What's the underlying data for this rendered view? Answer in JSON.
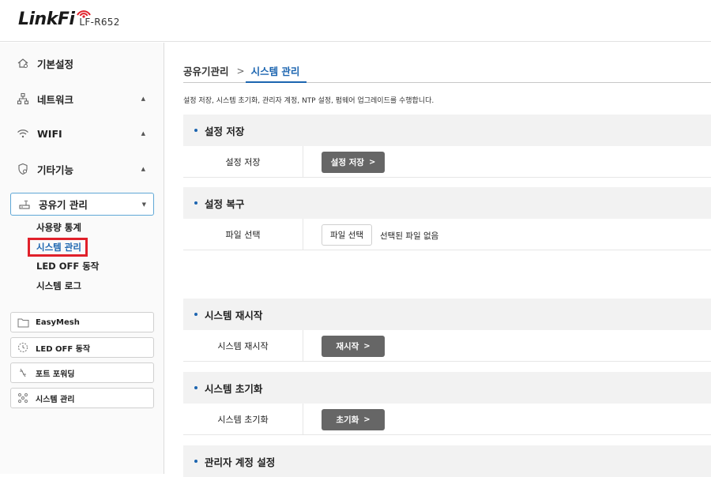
{
  "header": {
    "brand": "LinkFi",
    "model": "LF-R652"
  },
  "sidebar": {
    "menu": [
      {
        "label": "기본설정",
        "icon": "home-gear-icon"
      },
      {
        "label": "네트워크",
        "icon": "network-icon",
        "arrow": "▲"
      },
      {
        "label": "WIFI",
        "icon": "wifi-icon",
        "arrow": "▲"
      },
      {
        "label": "기타기능",
        "icon": "shield-gear-icon",
        "arrow": "▲"
      }
    ],
    "selected": {
      "label": "공유기 관리",
      "icon": "router-icon",
      "arrow": "▼"
    },
    "submenu": [
      "사용량 통계",
      "시스템 관리",
      "LED OFF 동작",
      "시스템 로그"
    ],
    "quick": [
      {
        "label": "EasyMesh",
        "icon": "folder-icon"
      },
      {
        "label": "LED OFF 동작",
        "icon": "clock-icon"
      },
      {
        "label": "포트 포워딩",
        "icon": "port-icon"
      },
      {
        "label": "시스템 관리",
        "icon": "nodes-icon"
      }
    ]
  },
  "main": {
    "breadcrumb": {
      "parent": "공유기관리",
      "separator": ">",
      "current": "시스템 관리"
    },
    "description": "설정 저장, 시스템 초기화, 관리자 계정, NTP 설정, 펌웨어 업그레이드를 수행합니다.",
    "sections": {
      "save": {
        "title": "설정 저장",
        "row_label": "설정 저장",
        "button": "설정 저장"
      },
      "restore": {
        "title": "설정 복구",
        "row_label": "파일 선택",
        "file_button": "파일 선택",
        "file_status": "선택된 파일 없음"
      },
      "reboot": {
        "title": "시스템 재시작",
        "row_label": "시스템 재시작",
        "button": "재시작"
      },
      "reset": {
        "title": "시스템 초기화",
        "row_label": "시스템 초기화",
        "button": "초기화"
      },
      "admin": {
        "title": "관리자 계정 설정"
      }
    },
    "chevron": ">"
  },
  "colors": {
    "accent": "#1c65b0",
    "button": "#666666",
    "highlight": "#e0202a",
    "select_border": "#5fa7d6"
  }
}
